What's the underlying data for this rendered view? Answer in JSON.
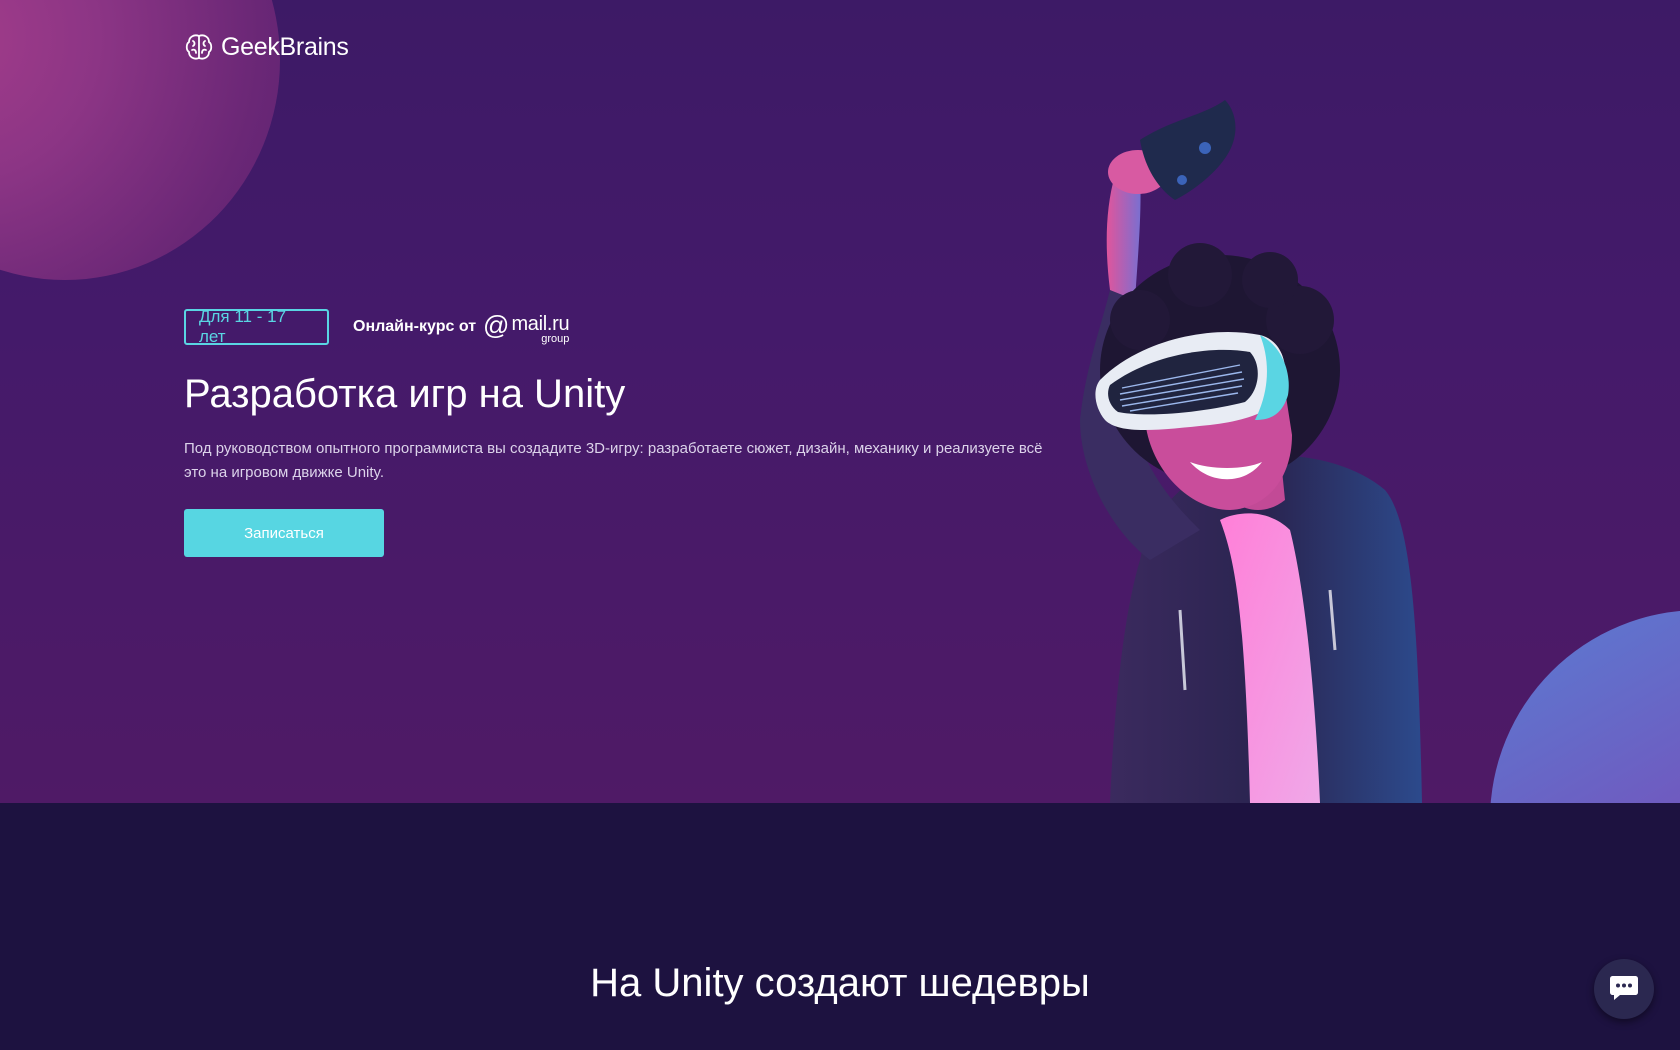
{
  "brand": {
    "name": "GeekBrains",
    "logo_icon": "brain-icon"
  },
  "hero": {
    "age_badge": "Для 11 - 17 лет",
    "course_from": "Онлайн-курс от",
    "partner": {
      "at": "@",
      "name": "mail.ru",
      "sub": "group"
    },
    "title": "Разработка игр на Unity",
    "description": "Под руководством опытного программиста вы создадите 3D-игру: разработаете сюжет, дизайн, механику и реализуете всё это на игровом движке Unity.",
    "cta_label": "Записаться"
  },
  "section": {
    "title": "На Unity создают шедевры"
  },
  "chat": {
    "icon": "chat-icon"
  },
  "colors": {
    "hero_bg": "#441a6a",
    "accent": "#57d6e2",
    "dark_bg": "#1d1240",
    "circle_pink": "#8c3585",
    "circle_blue": "#5a7cd2"
  }
}
